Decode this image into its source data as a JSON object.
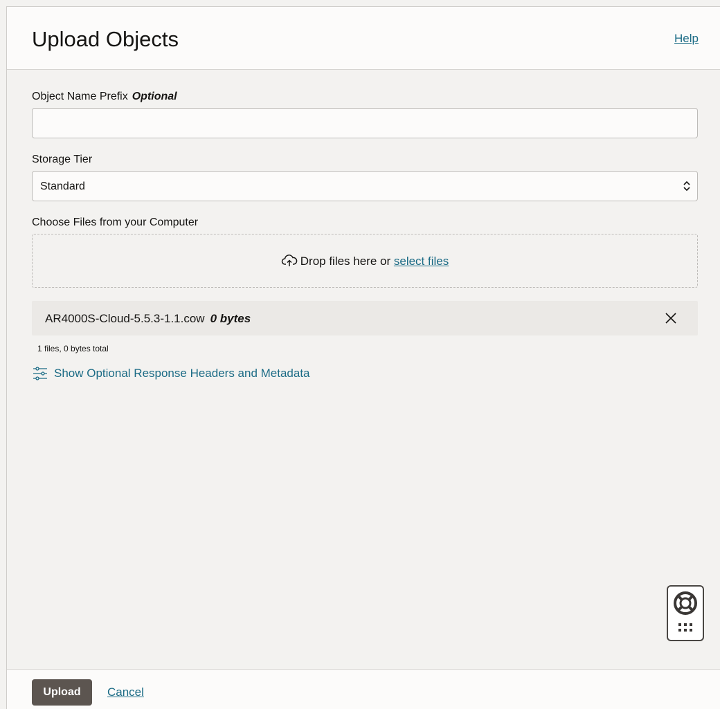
{
  "header": {
    "title": "Upload Objects",
    "help_label": "Help"
  },
  "prefix": {
    "label": "Object Name Prefix",
    "optional_label": "Optional",
    "value": "",
    "placeholder": ""
  },
  "storage_tier": {
    "label": "Storage Tier",
    "selected": "Standard"
  },
  "files": {
    "label": "Choose Files from your Computer",
    "drop_text": "Drop files here or",
    "select_link": "select files",
    "items": [
      {
        "name": "AR4000S-Cloud-5.5.3-1.1.cow",
        "size": "0 bytes"
      }
    ],
    "summary": "1 files, 0 bytes total"
  },
  "optional_headers_link": "Show Optional Response Headers and Metadata",
  "footer": {
    "upload_label": "Upload",
    "cancel_label": "Cancel"
  },
  "icons": {
    "upload": "cloud-upload-icon",
    "remove": "close-icon",
    "options": "sliders-icon",
    "support": "lifebuoy-icon"
  },
  "colors": {
    "link": "#1b6b85",
    "primary_button": "#5c5550"
  }
}
